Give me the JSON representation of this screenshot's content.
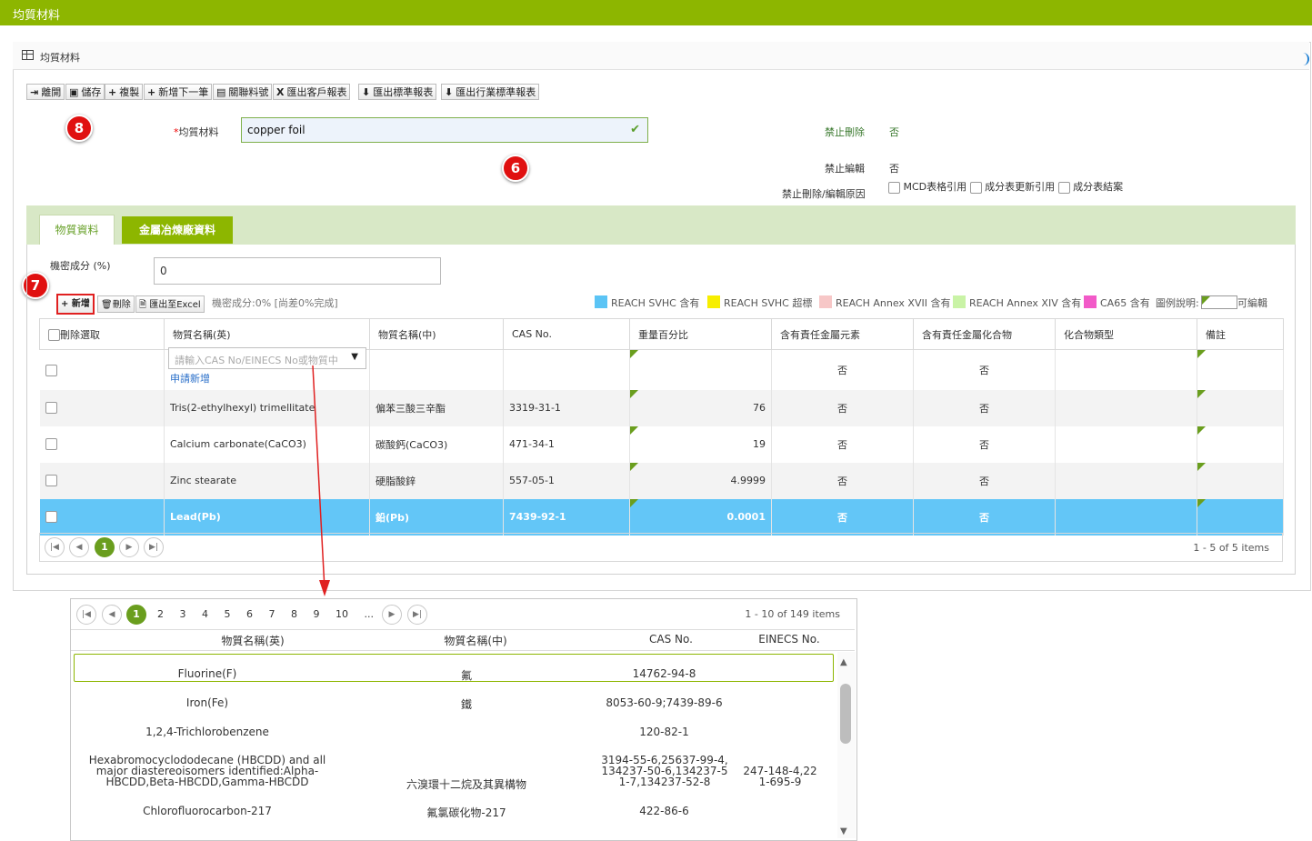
{
  "header": {
    "title": "均質材料"
  },
  "panel": {
    "title": "均質材料"
  },
  "toolbar": [
    {
      "icon": "exit-icon",
      "glyph": "⇥",
      "label": "離開"
    },
    {
      "icon": "save-icon",
      "glyph": "🖫",
      "label": "儲存"
    },
    {
      "icon": "plus-icon",
      "glyph": "+",
      "label": "複製"
    },
    {
      "icon": "plus-icon",
      "glyph": "+",
      "label": "新增下一筆"
    },
    {
      "icon": "document-icon",
      "glyph": "▤",
      "label": "關聯料號"
    },
    {
      "icon": "excel-icon",
      "glyph": "X",
      "label": "匯出客戶報表"
    },
    {
      "icon": "download-icon",
      "glyph": "⬇",
      "label": "匯出標準報表"
    },
    {
      "icon": "download-icon",
      "glyph": "⬇",
      "label": "匯出行業標準報表"
    }
  ],
  "annotations": {
    "badge8": "8",
    "badge6": "6",
    "badge7": "7"
  },
  "form": {
    "required_mark": "*",
    "material_label": "均質材料",
    "material_value": "copper foil",
    "no_delete_label": "禁止刪除",
    "no_delete_value": "否",
    "no_edit_label": "禁止編輯",
    "no_edit_value": "否",
    "reason_label": "禁止刪除/編輯原因",
    "reason_opts": [
      "MCD表格引用",
      "成分表更新引用",
      "成分表結案"
    ]
  },
  "tabs": [
    {
      "label": "物質資料"
    },
    {
      "label": "金屬冶煉廠資料"
    }
  ],
  "secret": {
    "label": "機密成分 (%)",
    "value": "0",
    "status": "機密成分:0% [尚差0%完成]"
  },
  "grid_toolbar": {
    "add": "新增",
    "delete": "刪除",
    "export": "匯出至Excel"
  },
  "legend": [
    {
      "color": "#5bc4f5",
      "label": "REACH SVHC 含有"
    },
    {
      "color": "#f7ee00",
      "label": "REACH SVHC 超標"
    },
    {
      "color": "#f7c7c7",
      "label": "REACH Annex XVII 含有"
    },
    {
      "color": "#c9f3a6",
      "label": "REACH Annex XIV 含有"
    },
    {
      "color": "#f25ac8",
      "label": "CA65 含有"
    }
  ],
  "legend_note": {
    "label": "圖例說明:",
    "editable": "可編輯"
  },
  "columns": [
    "刪除選取",
    "物質名稱(英)",
    "物質名稱(中)",
    "CAS No.",
    "重量百分比",
    "含有責任金屬元素",
    "含有責任金屬化合物",
    "化合物類型",
    "備註"
  ],
  "new_row": {
    "placeholder": "請輸入CAS No/EINECS No或物質中",
    "apply_link": "申請新增",
    "metal": "否",
    "compound": "否"
  },
  "rows": [
    {
      "en": "Tris(2-ethylhexyl) trimellitate",
      "zh": "偏苯三酸三辛酯",
      "cas": "3319-31-1",
      "pct": "76",
      "metal": "否",
      "compound": "否"
    },
    {
      "en": "Calcium carbonate(CaCO3)",
      "zh": "碳酸鈣(CaCO3)",
      "cas": "471-34-1",
      "pct": "19",
      "metal": "否",
      "compound": "否"
    },
    {
      "en": "Zinc stearate",
      "zh": "硬脂酸鋅",
      "cas": "557-05-1",
      "pct": "4.9999",
      "metal": "否",
      "compound": "否"
    },
    {
      "en": "Lead(Pb)",
      "zh": "鉛(Pb)",
      "cas": "7439-92-1",
      "pct": "0.0001",
      "metal": "否",
      "compound": "否"
    }
  ],
  "pager": {
    "current": "1",
    "summary": "1 - 5 of 5 items"
  },
  "popup": {
    "pages": [
      "1",
      "2",
      "3",
      "4",
      "5",
      "6",
      "7",
      "8",
      "9",
      "10",
      "..."
    ],
    "summary": "1 - 10 of 149 items",
    "columns": [
      "物質名稱(英)",
      "物質名稱(中)",
      "CAS No.",
      "EINECS No."
    ],
    "rows": [
      {
        "en": "Fluorine(F)",
        "zh": "氟",
        "cas": "14762-94-8",
        "einecs": ""
      },
      {
        "en": "Iron(Fe)",
        "zh": "鐵",
        "cas": "8053-60-9;7439-89-6",
        "einecs": ""
      },
      {
        "en": "1,2,4-Trichlorobenzene",
        "zh": "",
        "cas": "120-82-1",
        "einecs": ""
      },
      {
        "en": "Hexabromocyclododecane (HBCDD) and all major diastereoisomers identified:Alpha-HBCDD,Beta-HBCDD,Gamma-HBCDD",
        "zh": "六溴環十二烷及其異構物",
        "cas": "3194-55-6,25637-99-4,134237-50-6,134237-51-7,134237-52-8",
        "einecs": "247-148-4,221-695-9"
      },
      {
        "en": "Chlorofluorocarbon-217",
        "zh": "氟氯碳化物-217",
        "cas": "422-86-6",
        "einecs": ""
      }
    ]
  }
}
